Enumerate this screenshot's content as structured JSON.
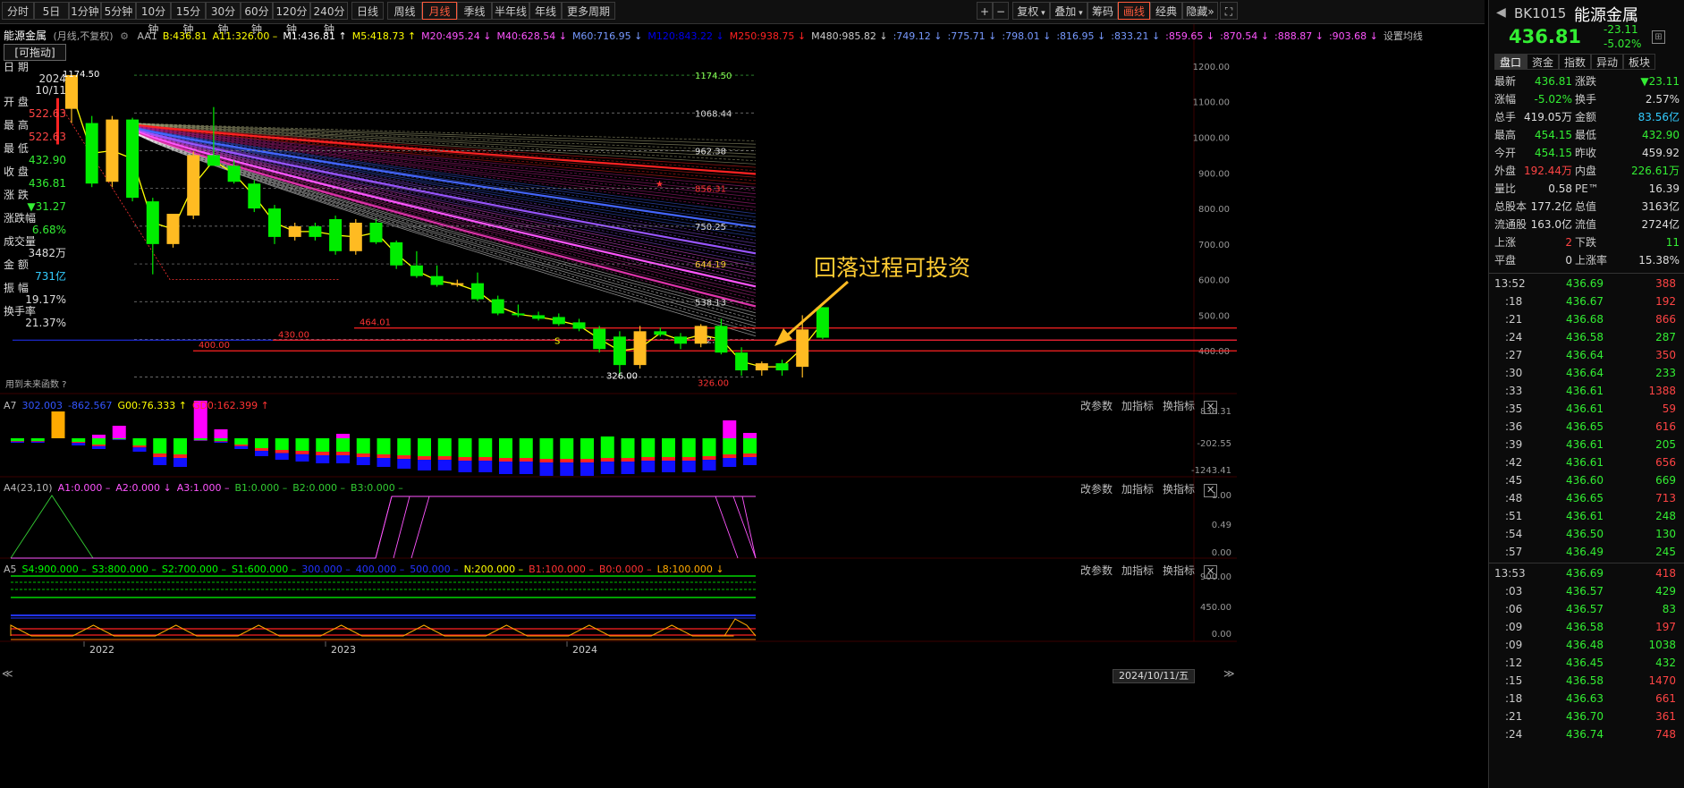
{
  "toolbar": {
    "periods": [
      "分时",
      "5日",
      "1分钟",
      "5分钟",
      "10分钟",
      "15分钟",
      "30分钟",
      "60分钟",
      "120分钟",
      "240分钟",
      "日线",
      "周线",
      "月线",
      "季线",
      "半年线",
      "年线",
      "更多周期"
    ],
    "active_period": "月线",
    "right_buttons": [
      "复权",
      "叠加",
      "筹码",
      "画线",
      "经典",
      "隐藏"
    ],
    "active_right": "画线"
  },
  "ma_header": {
    "title": "能源金属",
    "mode": "(月线,不复权)",
    "items": [
      {
        "t": "AA1",
        "c": "#bbbbbb"
      },
      {
        "t": "B:436.81",
        "c": "#ffff00"
      },
      {
        "t": "A11:326.00 –",
        "c": "#ffff00"
      },
      {
        "t": "M1:436.81 ↑",
        "c": "#ffffff"
      },
      {
        "t": "M5:418.73 ↑",
        "c": "#ffff00"
      },
      {
        "t": "M20:495.24 ↓",
        "c": "#ff55ff"
      },
      {
        "t": "M40:628.54 ↓",
        "c": "#ff55ff"
      },
      {
        "t": "M60:716.95 ↓",
        "c": "#7799ff"
      },
      {
        "t": "M120:843.22 ↓",
        "c": "#0000ee"
      },
      {
        "t": "M250:938.75 ↓",
        "c": "#ff2222"
      },
      {
        "t": "M480:985.82 ↓",
        "c": "#cccccc"
      },
      {
        "t": ":749.12 ↓",
        ":c": "",
        "c": "#7799ff"
      },
      {
        "t": ":775.71 ↓",
        "c": "#7799ff"
      },
      {
        "t": ":798.01 ↓",
        "c": "#7799ff"
      },
      {
        "t": ":816.95 ↓",
        "c": "#7799ff"
      },
      {
        "t": ":833.21 ↓",
        "c": "#7799ff"
      },
      {
        "t": ":859.65 ↓",
        "c": "#ff55ff"
      },
      {
        "t": ":870.54 ↓",
        "c": "#ff55ff"
      },
      {
        "t": ":888.87 ↓",
        "c": "#ff55ff"
      },
      {
        "t": ":903.68 ↓",
        "c": "#ff55ff"
      },
      {
        "t": "设置均线",
        "c": "#bbbbbb"
      }
    ]
  },
  "info_panel": {
    "badge": "[可拖动]",
    "rows": [
      {
        "label": "日  期",
        "value": "2024",
        "value2": "10/11",
        "color": "#dddddd"
      },
      {
        "label": "开  盘",
        "value": "522.63",
        "color": "#ff4444"
      },
      {
        "label": "最  高",
        "value": "522.63",
        "color": "#ff4444"
      },
      {
        "label": "最  低",
        "value": "432.90",
        "color": "#33ee33"
      },
      {
        "label": "收  盘",
        "value": "436.81",
        "color": "#33ee33"
      },
      {
        "label": "涨  跌",
        "value": "▼31.27",
        "color": "#33ee33"
      },
      {
        "label": "涨跌幅",
        "value": "6.68%",
        "color": "#33ee33"
      },
      {
        "label": "成交量",
        "value": "3482万",
        "color": "#dddddd"
      },
      {
        "label": "金  额",
        "value": "731亿",
        "color": "#33ccff"
      },
      {
        "label": "振  幅",
        "value": "19.17%",
        "color": "#dddddd"
      },
      {
        "label": "换手率",
        "value": "21.37%",
        "color": "#dddddd"
      }
    ],
    "footer": "用到未来函数  ?"
  },
  "main_chart": {
    "y_axis": [
      "1200.00",
      "1100.00",
      "1000.00",
      "900.00",
      "800.00",
      "700.00",
      "600.00",
      "500.00",
      "400.00"
    ],
    "level_labels": [
      "1174.50",
      "1068.44",
      "962.38",
      "856.31",
      "750.25",
      "644.19",
      "538.13",
      "432.07",
      "326.00"
    ],
    "hlines": [
      {
        "label": "464.01",
        "value": 464.01
      },
      {
        "label": "430.00",
        "value": 430.0
      },
      {
        "label": "400.00",
        "value": 400.0
      }
    ],
    "high_marker": "1174.50",
    "low_marker": "326.00",
    "s_marker": "S",
    "annotation": "回落过程可投资"
  },
  "chart_data": {
    "type": "candlestick",
    "title": "能源金属",
    "period": "月线",
    "x_labels": [
      "2022",
      "2023",
      "2024"
    ],
    "ylim": [
      300,
      1230
    ],
    "candles": [
      {
        "o": 1080,
        "h": 1174.5,
        "l": 1040,
        "c": 1175
      },
      {
        "o": 1040,
        "h": 1060,
        "l": 860,
        "c": 870
      },
      {
        "o": 875,
        "h": 1060,
        "l": 860,
        "c": 1050
      },
      {
        "o": 1050,
        "h": 1055,
        "l": 820,
        "c": 830
      },
      {
        "o": 820,
        "h": 830,
        "l": 615,
        "c": 700
      },
      {
        "o": 700,
        "h": 720,
        "l": 690,
        "c": 785
      },
      {
        "o": 780,
        "h": 960,
        "l": 770,
        "c": 950
      },
      {
        "o": 950,
        "h": 1085,
        "l": 920,
        "c": 920
      },
      {
        "o": 920,
        "h": 935,
        "l": 870,
        "c": 875
      },
      {
        "o": 870,
        "h": 880,
        "l": 790,
        "c": 800
      },
      {
        "o": 800,
        "h": 810,
        "l": 700,
        "c": 720
      },
      {
        "o": 720,
        "h": 760,
        "l": 710,
        "c": 750
      },
      {
        "o": 750,
        "h": 760,
        "l": 710,
        "c": 720
      },
      {
        "o": 770,
        "h": 780,
        "l": 670,
        "c": 680
      },
      {
        "o": 680,
        "h": 770,
        "l": 670,
        "c": 760
      },
      {
        "o": 760,
        "h": 770,
        "l": 700,
        "c": 705
      },
      {
        "o": 705,
        "h": 710,
        "l": 630,
        "c": 640
      },
      {
        "o": 640,
        "h": 680,
        "l": 605,
        "c": 610
      },
      {
        "o": 610,
        "h": 640,
        "l": 580,
        "c": 585
      },
      {
        "o": 585,
        "h": 600,
        "l": 580,
        "c": 590
      },
      {
        "o": 590,
        "h": 620,
        "l": 540,
        "c": 545
      },
      {
        "o": 545,
        "h": 555,
        "l": 500,
        "c": 505
      },
      {
        "o": 505,
        "h": 530,
        "l": 495,
        "c": 500
      },
      {
        "o": 500,
        "h": 510,
        "l": 485,
        "c": 490
      },
      {
        "o": 495,
        "h": 505,
        "l": 470,
        "c": 475
      },
      {
        "o": 480,
        "h": 490,
        "l": 455,
        "c": 462
      },
      {
        "o": 462,
        "h": 470,
        "l": 395,
        "c": 405
      },
      {
        "o": 440,
        "h": 455,
        "l": 330,
        "c": 360
      },
      {
        "o": 360,
        "h": 470,
        "l": 350,
        "c": 455
      },
      {
        "o": 455,
        "h": 465,
        "l": 440,
        "c": 445
      },
      {
        "o": 440,
        "h": 450,
        "l": 405,
        "c": 420
      },
      {
        "o": 420,
        "h": 475,
        "l": 410,
        "c": 470
      },
      {
        "o": 470,
        "h": 490,
        "l": 390,
        "c": 395
      },
      {
        "o": 395,
        "h": 410,
        "l": 330,
        "c": 345
      },
      {
        "o": 345,
        "h": 370,
        "l": 330,
        "c": 365
      },
      {
        "o": 365,
        "h": 375,
        "l": 330,
        "c": 345
      },
      {
        "o": 355,
        "h": 500,
        "l": 325,
        "c": 460
      },
      {
        "o": 522.63,
        "h": 522.63,
        "l": 432.9,
        "c": 436.81
      }
    ]
  },
  "sub1": {
    "header": [
      {
        "t": "A7",
        "c": "#bbbbbb"
      },
      {
        "t": "302.003",
        "c": "#3355ff"
      },
      {
        "t": "-862.567",
        "c": "#3355ff"
      },
      {
        "t": "G00:76.333 ↑",
        "c": "#ffff00"
      },
      {
        "t": "GD0:162.399 ↑",
        "c": "#ff3333"
      }
    ],
    "y_axis": [
      "838.31",
      "-202.55",
      "-1243.41"
    ],
    "bars": [
      {
        "top": 0,
        "bot": -5,
        "c": "#00ff00"
      },
      {
        "top": 0,
        "bot": -5,
        "c": "#00ff00"
      },
      {
        "top": 30,
        "bot": 0,
        "c": "#ffaa00"
      },
      {
        "top": 0,
        "bot": -8,
        "c": "#00ff00"
      },
      {
        "top": 4,
        "bot": -12,
        "c": "#ff00ff"
      },
      {
        "top": 14,
        "bot": -2,
        "c": "#ff00ff"
      },
      {
        "top": 0,
        "bot": -15,
        "c": "#00ff00"
      },
      {
        "top": 0,
        "bot": -30,
        "c": "#00ff00"
      },
      {
        "top": 0,
        "bot": -32,
        "c": "#00ff00"
      },
      {
        "top": 42,
        "bot": -3,
        "c": "#ff00ff"
      },
      {
        "top": 10,
        "bot": -5,
        "c": "#ff00ff"
      },
      {
        "top": 0,
        "bot": -12,
        "c": "#00ff00"
      },
      {
        "top": 0,
        "bot": -20,
        "c": "#00ff00"
      },
      {
        "top": 0,
        "bot": -24,
        "c": "#00ff00"
      },
      {
        "top": 0,
        "bot": -26,
        "c": "#00ff00"
      },
      {
        "top": 0,
        "bot": -28,
        "c": "#00ff00"
      },
      {
        "top": 5,
        "bot": -28,
        "c": "#ff00ff"
      },
      {
        "top": 0,
        "bot": -30,
        "c": "#00ff00"
      },
      {
        "top": 0,
        "bot": -32,
        "c": "#00ff00"
      },
      {
        "top": 0,
        "bot": -34,
        "c": "#00ff00"
      },
      {
        "top": 0,
        "bot": -36,
        "c": "#00ff00"
      },
      {
        "top": 0,
        "bot": -36,
        "c": "#00ff00"
      },
      {
        "top": 0,
        "bot": -38,
        "c": "#00ff00"
      },
      {
        "top": 0,
        "bot": -38,
        "c": "#00ff00"
      },
      {
        "top": 0,
        "bot": -40,
        "c": "#00ff00"
      },
      {
        "top": 0,
        "bot": -40,
        "c": "#00ff00"
      },
      {
        "top": 0,
        "bot": -42,
        "c": "#00ff00"
      },
      {
        "top": 0,
        "bot": -42,
        "c": "#00ff00"
      },
      {
        "top": 0,
        "bot": -42,
        "c": "#00ff00"
      },
      {
        "top": 2,
        "bot": -40,
        "c": "#00ff00"
      },
      {
        "top": 0,
        "bot": -40,
        "c": "#00ff00"
      },
      {
        "top": 0,
        "bot": -38,
        "c": "#00ff00"
      },
      {
        "top": 0,
        "bot": -38,
        "c": "#00ff00"
      },
      {
        "top": 0,
        "bot": -38,
        "c": "#00ff00"
      },
      {
        "top": 0,
        "bot": -36,
        "c": "#00ff00"
      },
      {
        "top": 20,
        "bot": -32,
        "c": "#ff00ff"
      },
      {
        "top": 6,
        "bot": -30,
        "c": "#ff00ff"
      }
    ]
  },
  "sub2": {
    "header": [
      {
        "t": "A4(23,10)",
        "c": "#bbbbbb"
      },
      {
        "t": "A1:0.000 –",
        "c": "#ff55ff"
      },
      {
        "t": "A2:0.000 ↓",
        "c": "#ff55ff"
      },
      {
        "t": "A3:1.000 –",
        "c": "#ff55ff"
      },
      {
        "t": "B1:0.000 –",
        "c": "#33cc33"
      },
      {
        "t": "B2:0.000 –",
        "c": "#33cc33"
      },
      {
        "t": "B3:0.000 –",
        "c": "#33cc33"
      }
    ],
    "y_axis": [
      "1.00",
      "0.49",
      "0.00"
    ]
  },
  "sub3": {
    "header": [
      {
        "t": "A5",
        "c": "#bbbbbb"
      },
      {
        "t": "S4:900.000 –",
        "c": "#00ff00"
      },
      {
        "t": "S3:800.000 –",
        "c": "#00ff00"
      },
      {
        "t": "S2:700.000 –",
        "c": "#00ff00"
      },
      {
        "t": "S1:600.000 –",
        "c": "#00ff00"
      },
      {
        "t": "300.000 –",
        "c": "#2233ff"
      },
      {
        "t": "400.000 –",
        "c": "#2233ff"
      },
      {
        "t": "500.000 –",
        "c": "#2233ff"
      },
      {
        "t": "N:200.000 –",
        "c": "#ffff00"
      },
      {
        "t": "B1:100.000 –",
        "c": "#ff3333"
      },
      {
        "t": "B0:0.000 –",
        "c": "#ff3333"
      },
      {
        "t": "L8:100.000 ↓",
        "c": "#ffaa00"
      }
    ],
    "y_axis": [
      "900.00",
      "450.00",
      "0.00"
    ]
  },
  "sub_buttons": [
    "改参数",
    "加指标",
    "换指标"
  ],
  "bottom_axis": {
    "labels": [
      "2022",
      "2023",
      "2024"
    ],
    "date_box": "2024/10/11/五"
  },
  "right_panel": {
    "code": "BK1015",
    "name": "能源金属",
    "price": "436.81",
    "change": "-23.11",
    "change_pct": "-5.02%",
    "tabs": [
      "盘口",
      "资金",
      "指数",
      "异动",
      "板块"
    ],
    "active_tab": "盘口",
    "stats": [
      {
        "l1": "最新",
        "v1": "436.81",
        "c1": "#33ee33",
        "l2": "涨跌",
        "v2": "▼23.11",
        "c2": "#33ee33"
      },
      {
        "l1": "涨幅",
        "v1": "-5.02%",
        "c1": "#33ee33",
        "l2": "换手",
        "v2": "2.57%",
        "c2": "#dddddd"
      },
      {
        "l1": "总手",
        "v1": "419.05万",
        "c1": "#dddddd",
        "l2": "金额",
        "v2": "83.56亿",
        "c2": "#33ccff"
      },
      {
        "l1": "最高",
        "v1": "454.15",
        "c1": "#33ee33",
        "l2": "最低",
        "v2": "432.90",
        "c2": "#33ee33"
      },
      {
        "l1": "今开",
        "v1": "454.15",
        "c1": "#33ee33",
        "l2": "昨收",
        "v2": "459.92",
        "c2": "#dddddd"
      },
      {
        "l1": "外盘",
        "v1": "192.44万",
        "c1": "#ff4444",
        "l2": "内盘",
        "v2": "226.61万",
        "c2": "#33ee33"
      },
      {
        "l1": "量比",
        "v1": "0.58",
        "c1": "#dddddd",
        "l2": "PE™",
        "v2": "16.39",
        "c2": "#dddddd"
      },
      {
        "l1": "总股本",
        "v1": "177.2亿",
        "c1": "#dddddd",
        "l2": "总值",
        "v2": "3163亿",
        "c2": "#dddddd"
      },
      {
        "l1": "流通股",
        "v1": "163.0亿",
        "c1": "#dddddd",
        "l2": "流值",
        "v2": "2724亿",
        "c2": "#dddddd"
      },
      {
        "l1": "上涨",
        "v1": "2",
        "c1": "#ff4444",
        "l2": "下跌",
        "v2": "11",
        "c2": "#33ee33"
      },
      {
        "l1": "平盘",
        "v1": "0",
        "c1": "#dddddd",
        "l2": "上涨率",
        "v2": "15.38%",
        "c2": "#dddddd"
      }
    ],
    "ticks": [
      {
        "t": "13:52",
        "p": "436.69",
        "v": "388",
        "vc": "#ff4444"
      },
      {
        "t": ":18",
        "p": "436.67",
        "v": "192",
        "vc": "#ff4444"
      },
      {
        "t": ":21",
        "p": "436.68",
        "v": "866",
        "vc": "#ff4444"
      },
      {
        "t": ":24",
        "p": "436.58",
        "v": "287",
        "vc": "#33ee33"
      },
      {
        "t": ":27",
        "p": "436.64",
        "v": "350",
        "vc": "#ff4444"
      },
      {
        "t": ":30",
        "p": "436.64",
        "v": "233",
        "vc": "#33ee33"
      },
      {
        "t": ":33",
        "p": "436.61",
        "v": "1388",
        "vc": "#ff4444"
      },
      {
        "t": ":35",
        "p": "436.61",
        "v": "59",
        "vc": "#ff4444"
      },
      {
        "t": ":36",
        "p": "436.65",
        "v": "616",
        "vc": "#ff4444"
      },
      {
        "t": ":39",
        "p": "436.61",
        "v": "205",
        "vc": "#33ee33"
      },
      {
        "t": ":42",
        "p": "436.61",
        "v": "656",
        "vc": "#ff4444"
      },
      {
        "t": ":45",
        "p": "436.60",
        "v": "669",
        "vc": "#33ee33"
      },
      {
        "t": ":48",
        "p": "436.65",
        "v": "713",
        "vc": "#ff4444"
      },
      {
        "t": ":51",
        "p": "436.61",
        "v": "248",
        "vc": "#33ee33"
      },
      {
        "t": ":54",
        "p": "436.50",
        "v": "130",
        "vc": "#33ee33"
      },
      {
        "t": ":57",
        "p": "436.49",
        "v": "245",
        "vc": "#33ee33"
      },
      {
        "t": "13:53",
        "p": "436.69",
        "v": "418",
        "vc": "#ff4444"
      },
      {
        "t": ":03",
        "p": "436.57",
        "v": "429",
        "vc": "#33ee33"
      },
      {
        "t": ":06",
        "p": "436.57",
        "v": "83",
        "vc": "#33ee33"
      },
      {
        "t": ":09",
        "p": "436.58",
        "v": "197",
        "vc": "#ff4444"
      },
      {
        "t": ":09",
        "p": "436.48",
        "v": "1038",
        "vc": "#33ee33"
      },
      {
        "t": ":12",
        "p": "436.45",
        "v": "432",
        "vc": "#33ee33"
      },
      {
        "t": ":15",
        "p": "436.58",
        "v": "1470",
        "vc": "#ff4444"
      },
      {
        "t": ":18",
        "p": "436.63",
        "v": "661",
        "vc": "#ff4444"
      },
      {
        "t": ":21",
        "p": "436.70",
        "v": "361",
        "vc": "#ff4444"
      },
      {
        "t": ":24",
        "p": "436.74",
        "v": "748",
        "vc": "#ff4444"
      }
    ]
  }
}
